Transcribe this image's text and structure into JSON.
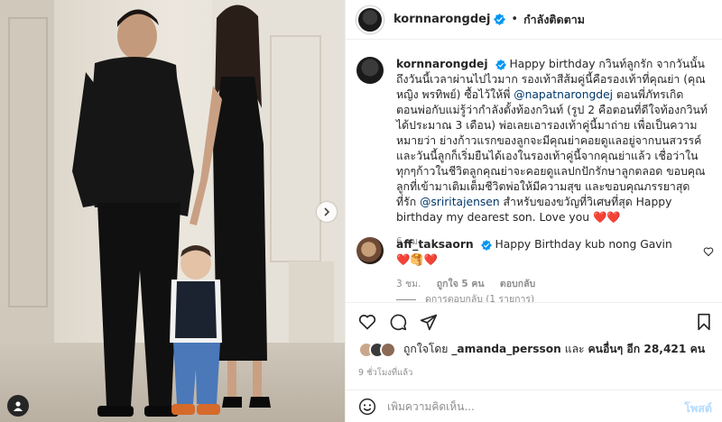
{
  "header": {
    "username": "kornnarongdej",
    "separator": "•",
    "follow_status": "กำลังติดตาม"
  },
  "caption": {
    "username": "kornnarongdej",
    "text_1": "Happy birthday กวินท์ลูกรัก จากวันนั้นถึงวันนี้เวลาผ่านไปไวมาก รองเท้าสีส้มคู่นี้คือรองเท้าที่คุณย่า (คุณหญิง พรทิพย์) ซื้อไว้ให้พี่ ",
    "mention_1": "@napatnarongdej",
    "text_2": " ตอนพี่ภัทรเกิด ตอนพ่อกับแม่รู้ว่ากำลังตั้งท้องกวินท์ (รูป 2 คือตอนที่ดีใจท้องกวินท์ได้ประมาณ 3 เดือน) พ่อเลยเอารองเท้าคู่นี้มาถ่าย เพื่อเป็นความหมายว่า ย่างก้าวแรกของลูกจะมีคุณย่าคอยดูแลอยู่จากบนสวรรค์ และวันนี้ลูกก็เริ่มยืนได้เองในรองเท้าคู่นี้จากคุณย่าแล้ว เชื่อว่าในทุกๆก้าวในชีวิตลูกคุณย่าจะคอยดูแลปกปักรักษาลูกตลอด ขอบคุณลูกที่เข้ามาเติมเต็มชีวิตพ่อให้มีความสุข และขอบคุณภรรยาสุดที่รัก ",
    "mention_2": "@sriritajensen",
    "text_3": " สำหรับของขวัญที่วิเศษที่สุด Happy birthday my dearest son. Love you ",
    "emoji": "❤️❤️",
    "time": "6 ชม."
  },
  "comment": {
    "username": "aff_taksaorn",
    "text": "Happy Birthday kub nong Gavin ",
    "emoji": "❤️🥞❤️",
    "time": "3 ชม.",
    "likes": "ถูกใจ 5 คน",
    "reply": "ตอบกลับ",
    "view_replies": "ดูการตอบกลับ (1 รายการ)"
  },
  "likes": {
    "prefix": "ถูกใจโดย ",
    "user": "_amanda_persson",
    "middle": " และ ",
    "others": "คนอื่นๆ อีก 28,421 คน"
  },
  "timestamp": "9 ชั่วโมงที่แล้ว",
  "add_comment": {
    "placeholder": "เพิ่มความคิดเห็น...",
    "post_label": "โพสต์"
  },
  "colors": {
    "verified": "#0095f6",
    "mention": "#00376b",
    "heart": "#ed4956",
    "post_disabled": "#b3dbff"
  }
}
